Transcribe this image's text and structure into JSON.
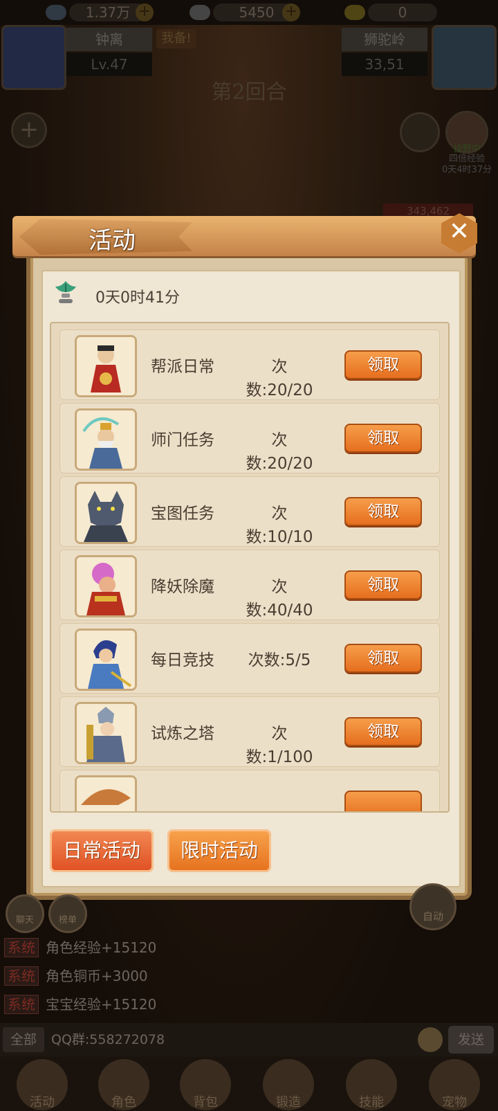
{
  "currency": {
    "silver": "1.37万",
    "gold": "5450",
    "ingot": "0"
  },
  "player": {
    "name": "钟离",
    "level": "Lv.47",
    "battle_tag": "我备!"
  },
  "opponent": {
    "name": "狮驼岭",
    "value": "33,51"
  },
  "battle": {
    "round": "第2回合",
    "boost_label": "四倍经验",
    "boost_state": "挂野中",
    "boost_time": "0天4时37分",
    "hp_bar": "343,462"
  },
  "panel": {
    "title": "活动",
    "close_glyph": "✕",
    "timer": "0天0时41分",
    "activities": [
      {
        "name": "帮派日常",
        "count": "次数:20/20",
        "button": "领取",
        "avatar": "sage-avatar"
      },
      {
        "name": "师门任务",
        "count": "次数:20/20",
        "button": "领取",
        "avatar": "elder-avatar"
      },
      {
        "name": "宝图任务",
        "count": "次数:10/10",
        "button": "领取",
        "avatar": "wolf-avatar"
      },
      {
        "name": "降妖除魔",
        "count": "次数:40/40",
        "button": "领取",
        "avatar": "demon-avatar"
      },
      {
        "name": "每日竞技",
        "count": "次数:5/5",
        "button": "领取",
        "avatar": "warrior-avatar"
      },
      {
        "name": "试炼之塔",
        "count": "次数:1/100",
        "button": "领取",
        "avatar": "general-avatar"
      }
    ],
    "tabs": {
      "daily": "日常活动",
      "limited": "限时活动"
    }
  },
  "log": [
    {
      "tag": "系统",
      "msg": "角色经验+15120"
    },
    {
      "tag": "系统",
      "msg": "角色铜币+3000"
    },
    {
      "tag": "系统",
      "msg": "宝宝经验+15120"
    }
  ],
  "chat": {
    "channel": "全部",
    "text": "QQ群:558272078",
    "send": "发送"
  },
  "side": {
    "chat": "聊天",
    "rank": "榜单",
    "auto": "自动"
  },
  "nav": [
    "活动",
    "角色",
    "背包",
    "锻造",
    "技能",
    "宠物"
  ]
}
